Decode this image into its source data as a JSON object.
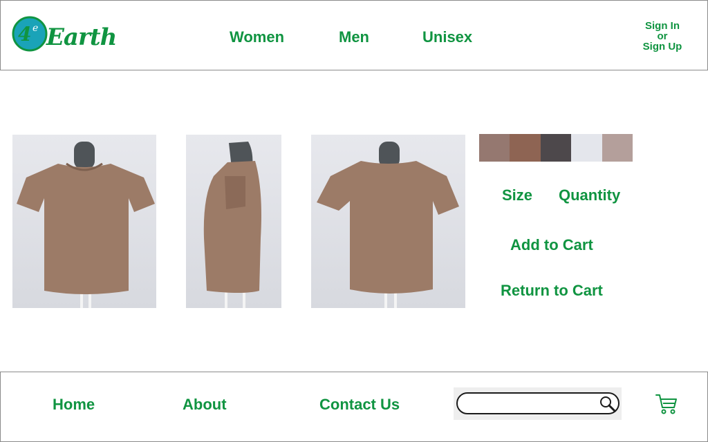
{
  "header": {
    "logo_text": "Earth",
    "logo_mark": "4e",
    "nav": [
      {
        "label": "Women"
      },
      {
        "label": "Men"
      },
      {
        "label": "Unisex"
      }
    ],
    "auth": {
      "sign_in": "Sign In",
      "or": "or",
      "sign_up": "Sign Up"
    }
  },
  "product": {
    "images": [
      {
        "view": "front",
        "alt": "front view"
      },
      {
        "view": "side",
        "alt": "side view"
      },
      {
        "view": "back",
        "alt": "back view"
      }
    ],
    "swatches": [
      "#957870",
      "#8e6453",
      "#4d484b",
      "#e4e6ec",
      "#b49f9b"
    ],
    "shirt_color": "#9c7b67",
    "size_label": "Size",
    "quantity_label": "Quantity",
    "add_to_cart": "Add to Cart",
    "return_to_cart": "Return to Cart"
  },
  "footer": {
    "links": [
      {
        "label": "Home"
      },
      {
        "label": "About"
      },
      {
        "label": "Contact Us"
      }
    ],
    "search": {
      "placeholder": "",
      "icon": "search-icon"
    },
    "cart_icon": "cart-icon"
  },
  "colors": {
    "brand_green": "#109441",
    "logo_circle": "#1aa3b8",
    "border": "#8a8a8a"
  }
}
